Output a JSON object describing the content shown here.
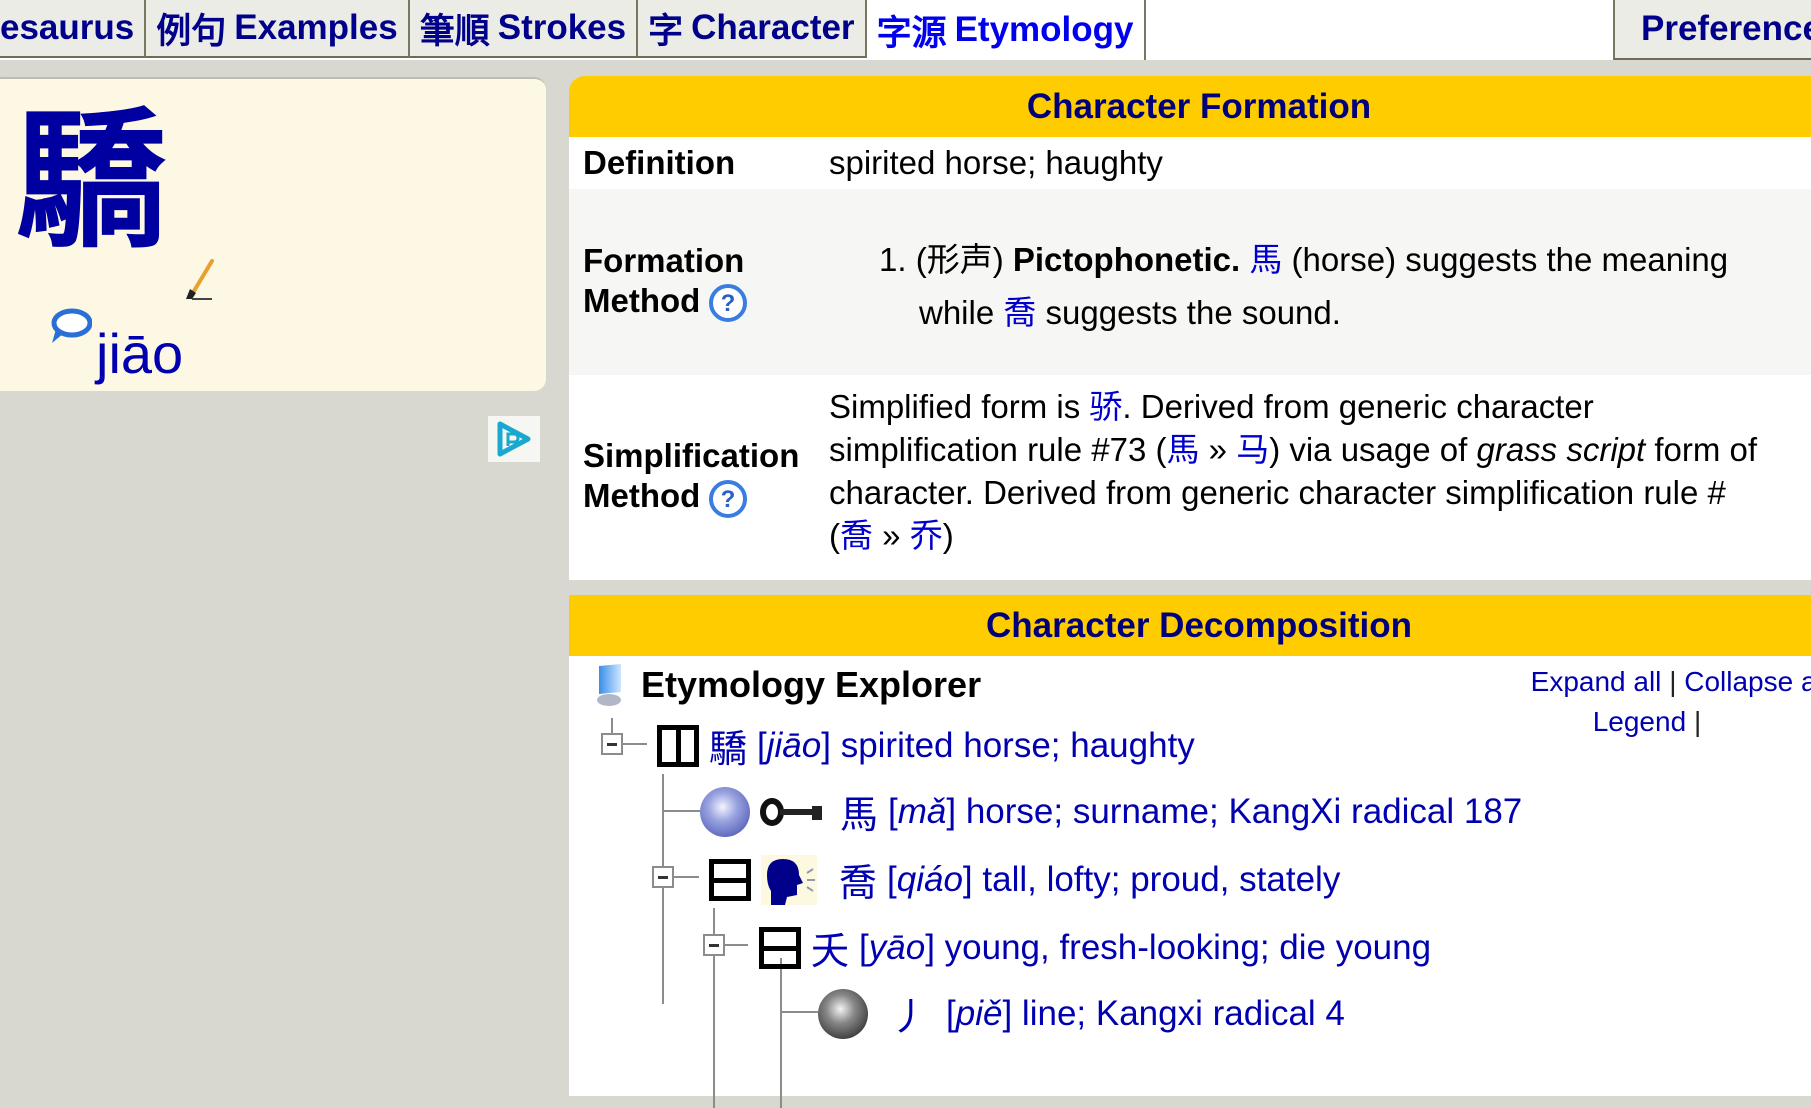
{
  "tabs": [
    {
      "cjk": "",
      "label": "esaurus",
      "active": false
    },
    {
      "cjk": "例句",
      "label": "Examples",
      "active": false
    },
    {
      "cjk": "筆順",
      "label": "Strokes",
      "active": false
    },
    {
      "cjk": "字",
      "label": "Character",
      "active": false
    },
    {
      "cjk": "字源",
      "label": "Etymology",
      "active": true
    }
  ],
  "preferences_label": "Preferences",
  "character": {
    "glyph": "驕",
    "pinyin": "jiāo",
    "icons": [
      "brush-icon",
      "speak-icon",
      "ad-choices-icon"
    ]
  },
  "formation": {
    "header": "Character Formation",
    "definition_label": "Definition",
    "definition_value": "spirited horse; haughty",
    "formation_label_1": "Formation",
    "formation_label_2": "Method",
    "formation_num": "1.",
    "formation_type_zh": "(形声)",
    "formation_type": "Pictophonetic.",
    "formation_char1": "馬",
    "formation_text1": "(horse) suggests the meaning",
    "formation_text2": "while",
    "formation_char2": "喬",
    "formation_text3": "suggests the sound.",
    "simplification_label_1": "Simplification",
    "simplification_label_2": "Method",
    "simp_text1": "Simplified form is",
    "simp_char1": "骄",
    "simp_text2": ". Derived from generic character",
    "simp_text3": "simplification rule #73 (",
    "simp_char2": "馬",
    "simp_arrow": " » ",
    "simp_char3": "马",
    "simp_text4": ") via usage of",
    "simp_italic": "grass script",
    "simp_text5": "form of",
    "simp_text6": "character. Derived from generic character simplification rule #",
    "simp_char4": "喬",
    "simp_char5": "乔"
  },
  "decomposition": {
    "header": "Character Decomposition",
    "explorer_title": "Etymology Explorer",
    "expand_all": "Expand all",
    "collapse_all": "Collapse all",
    "legend": "Legend",
    "separator": "|",
    "nodes": [
      {
        "char": "驕",
        "pinyin": "jiāo",
        "meaning": "spirited horse; haughty",
        "structure": "left-right",
        "role": ""
      },
      {
        "char": "馬",
        "pinyin": "mǎ",
        "meaning": "horse; surname; KangXi radical 187",
        "structure": "radical",
        "role": "meaning"
      },
      {
        "char": "喬",
        "pinyin": "qiáo",
        "meaning": "tall, lofty; proud, stately",
        "structure": "top-bottom",
        "role": "sound"
      },
      {
        "char": "夭",
        "pinyin": "yāo",
        "meaning": "young, fresh-looking; die young",
        "structure": "top-bottom",
        "role": ""
      },
      {
        "char": "丿",
        "pinyin": "piě",
        "meaning": "line; Kangxi radical 4",
        "structure": "radical-black",
        "role": ""
      }
    ]
  },
  "colors": {
    "header_yellow": "#ffcc00",
    "link_blue": "#0000b0",
    "panel_cream": "#fdf8e3",
    "page_gray": "#d8d8d0"
  }
}
